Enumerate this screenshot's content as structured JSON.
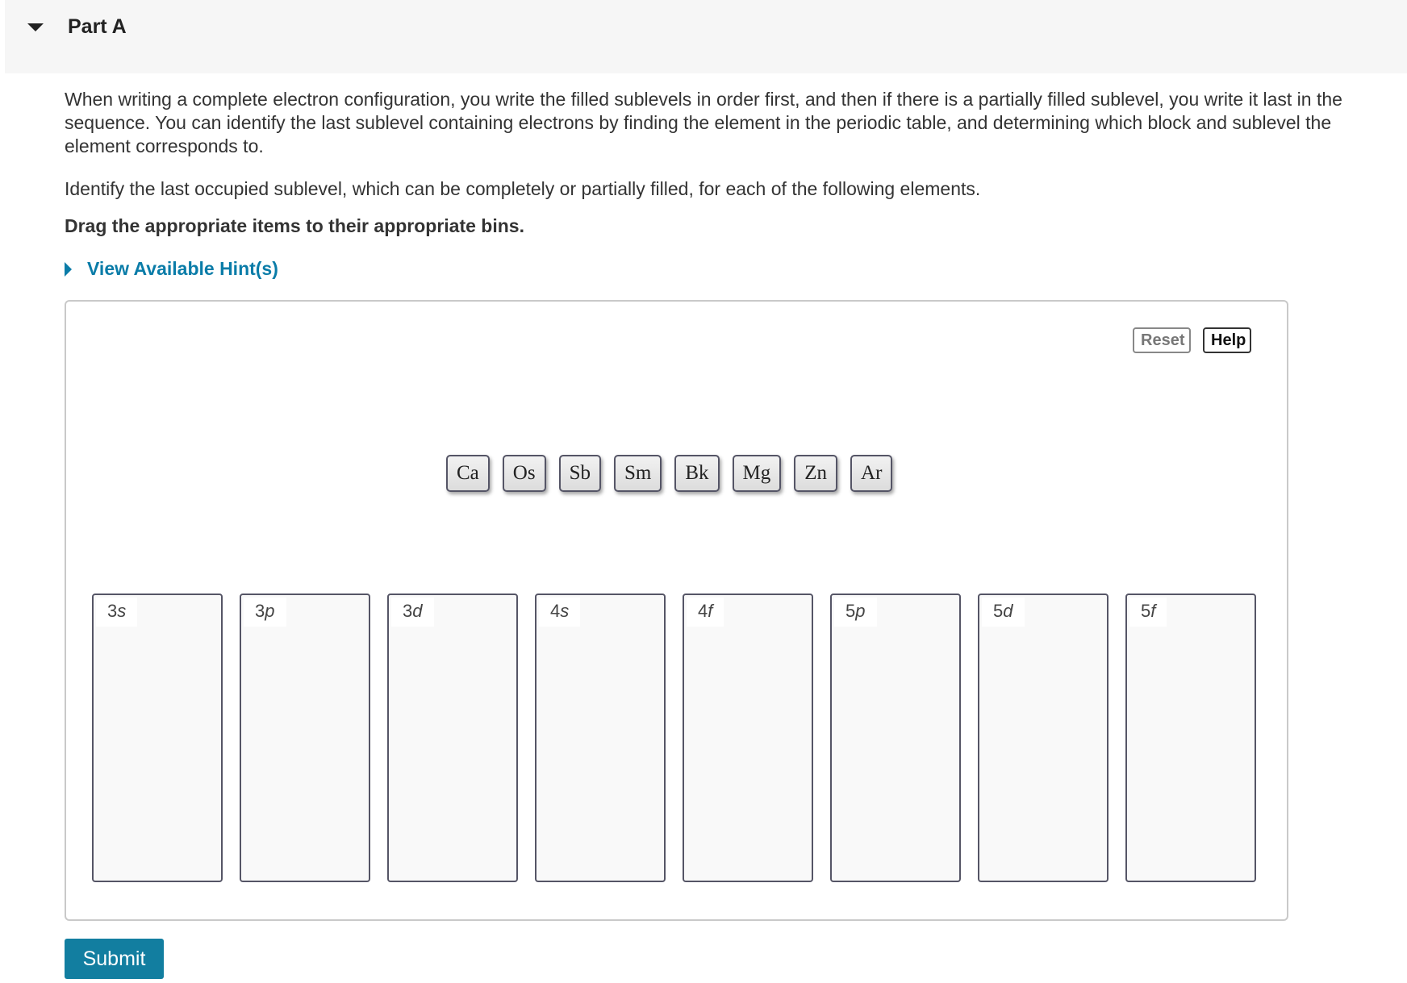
{
  "part": {
    "title": "Part A"
  },
  "instructions": {
    "paragraph1": "When writing a complete electron configuration, you write the filled sublevels in order first, and then if there is a partially filled sublevel, you write it last in the sequence. You can identify the last sublevel containing electrons by finding the element in the periodic table, and determining which block and sublevel the element corresponds to.",
    "paragraph2": "Identify the last occupied sublevel, which can be completely or partially filled, for each of the following elements.",
    "paragraph3": "Drag the appropriate items to their appropriate bins."
  },
  "hints": {
    "label": "View Available Hint(s)"
  },
  "toolbar": {
    "reset_label": "Reset",
    "help_label": "Help"
  },
  "items": [
    "Ca",
    "Os",
    "Sb",
    "Sm",
    "Bk",
    "Mg",
    "Zn",
    "Ar"
  ],
  "bins": [
    {
      "number": "3",
      "orbital": "s"
    },
    {
      "number": "3",
      "orbital": "p"
    },
    {
      "number": "3",
      "orbital": "d"
    },
    {
      "number": "4",
      "orbital": "s"
    },
    {
      "number": "4",
      "orbital": "f"
    },
    {
      "number": "5",
      "orbital": "p"
    },
    {
      "number": "5",
      "orbital": "d"
    },
    {
      "number": "5",
      "orbital": "f"
    }
  ],
  "submit_label": "Submit",
  "colors": {
    "accent": "#127ea0",
    "link": "#0a7ca8",
    "header_bg": "#f6f6f6"
  }
}
